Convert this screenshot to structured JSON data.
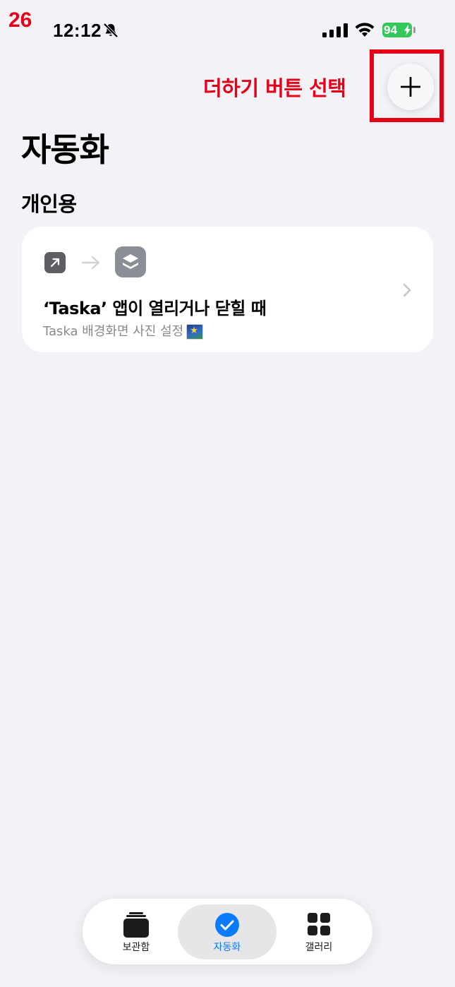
{
  "step_number": "26",
  "status_bar": {
    "time": "12:12",
    "battery": "94"
  },
  "annotation": {
    "text": "더하기 버튼 선택"
  },
  "header": {
    "title": "자동화",
    "section": "개인용"
  },
  "automation_card": {
    "title": "‘Taska’ 앱이 열리거나 닫힐 때",
    "subtitle": "Taska 배경화면 사진 설정"
  },
  "tabs": [
    {
      "label": "보관함",
      "icon": "library-icon",
      "selected": false
    },
    {
      "label": "자동화",
      "icon": "automation-check-icon",
      "selected": true
    },
    {
      "label": "갤러리",
      "icon": "gallery-grid-icon",
      "selected": false
    }
  ],
  "colors": {
    "annotation_red": "#e5001a",
    "accent_blue": "#0a7aff",
    "battery_green": "#34c759",
    "background": "#f2f2f7"
  }
}
